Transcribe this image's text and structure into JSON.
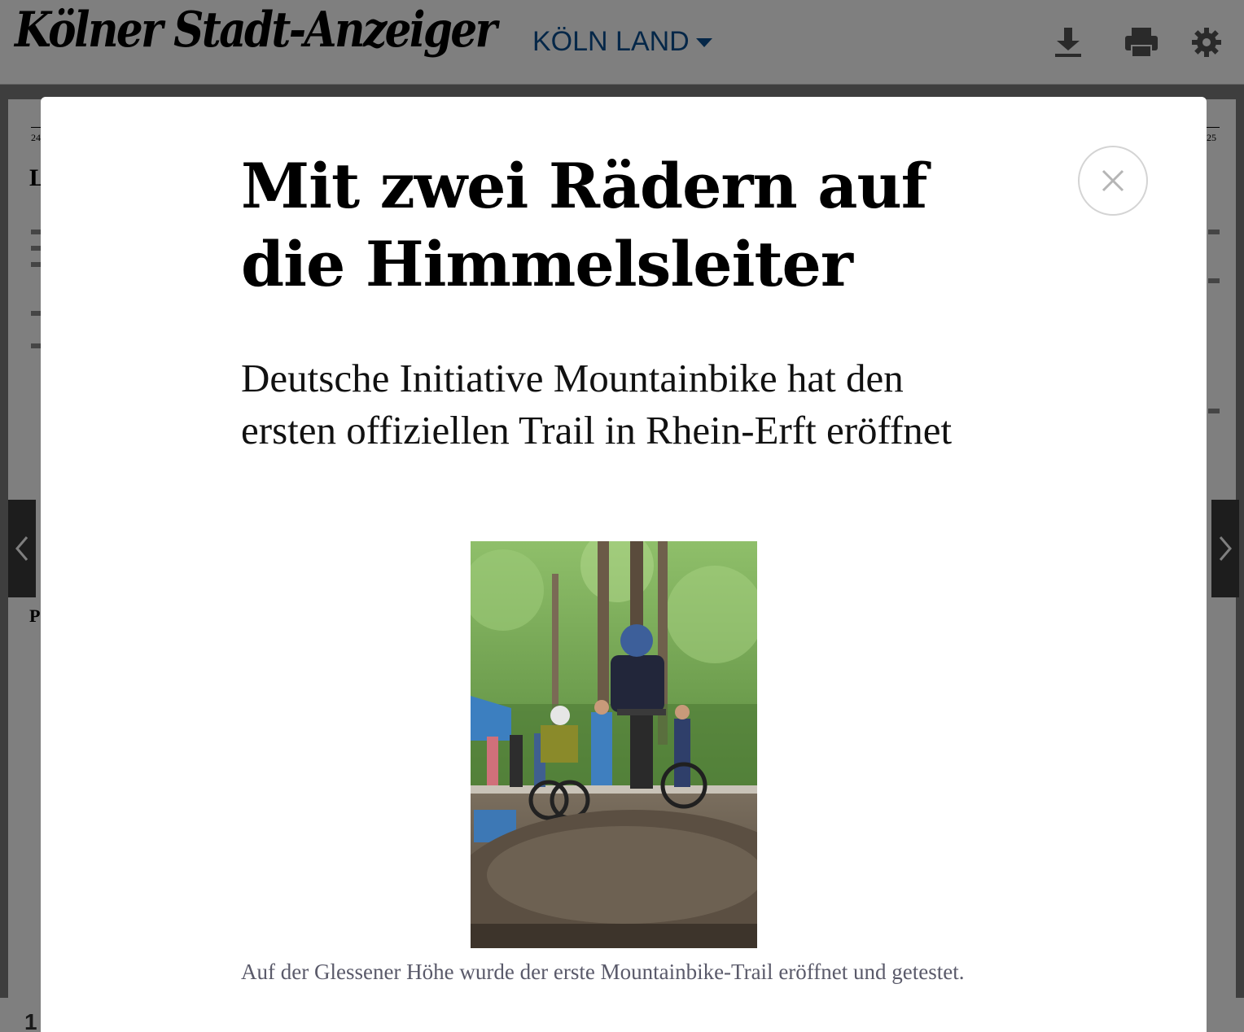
{
  "header": {
    "logo": "Kölner Stadt-Anzeiger",
    "edition": "KÖLN LAND",
    "icons": [
      "download-icon",
      "print-icon",
      "gear-icon"
    ]
  },
  "paper": {
    "left_page_number": "24",
    "right_page_number": "25",
    "bottom_page_number": "1"
  },
  "article": {
    "title": "Mit zwei Rädern auf die Himmelsleiter",
    "subtitle": "Deutsche Initiative Mountainbike hat den ersten offiziellen Trail in Rhein-Erft eröffnet",
    "caption": "Auf der Glessener Höhe wurde der erste Mountainbike-Trail eröffnet und getestet."
  },
  "colors": {
    "edition_blue": "#0b4f91",
    "caption_gray": "#5a5a6a",
    "overlay": "rgba(0,0,0,0.5)"
  }
}
